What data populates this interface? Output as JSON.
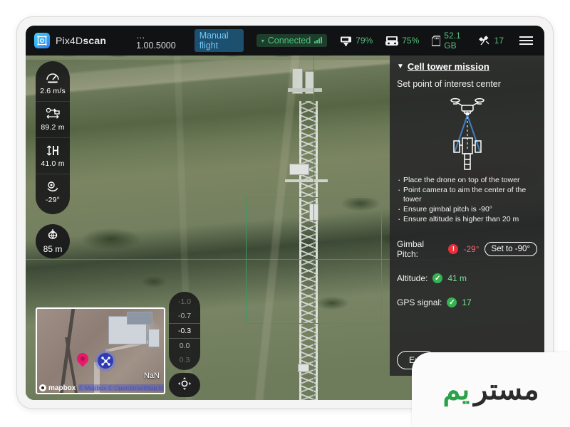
{
  "app": {
    "logo_icon": "pix4d-scan-logo-icon",
    "name_prefix": "Pix4D",
    "name_suffix": "scan",
    "version": "…1.00.5000",
    "flight_mode": "Manual flight",
    "connection": "Connected",
    "connection_caret_icon": "chevron-down-icon",
    "signal_icon": "signal-bars-icon",
    "menu_icon": "hamburger-menu-icon"
  },
  "status_bar": [
    {
      "icon": "drone-battery-icon",
      "value": "79%"
    },
    {
      "icon": "controller-battery-icon",
      "value": "75%"
    },
    {
      "icon": "sd-card-icon",
      "value": "52.1 GB"
    },
    {
      "icon": "satellite-icon",
      "value": "17"
    }
  ],
  "telemetry": [
    {
      "icon": "horizontal-speed-icon",
      "value": "2.6 m/s",
      "name": "speed"
    },
    {
      "icon": "horizontal-distance-icon",
      "value": "89.2 m",
      "name": "distance"
    },
    {
      "icon": "altitude-icon",
      "value": "41.0 m",
      "name": "altitude"
    },
    {
      "icon": "gimbal-pitch-icon",
      "value": "-29°",
      "name": "gimbal"
    }
  ],
  "distance_badge": {
    "icon": "home-distance-icon",
    "value": "85 m"
  },
  "gimbal_slider": {
    "ticks": [
      "-1.0",
      "-0.7",
      "-0.3",
      "0.0",
      "0.3"
    ],
    "current": "-0.3",
    "button_icon": "gimbal-control-icon"
  },
  "minimap": {
    "attribution_brand": "mapbox",
    "attribution_links": "© Mapbox  © OpenStreetMap  Improve this map",
    "place_label": "NaN",
    "marker_icon": "map-pin-icon",
    "drone_icon": "drone-marker-icon"
  },
  "panel": {
    "title": "Cell tower mission",
    "caret_icon": "caret-down-icon",
    "subtitle": "Set point of interest center",
    "diagram_icon": "drone-over-tower-diagram",
    "instructions": [
      "Place the drone on top of the tower",
      "Point camera to aim the center of the tower",
      "Ensure gimbal pitch is -90°",
      "Ensure altitude is higher than 20 m"
    ],
    "checks": [
      {
        "label": "Gimbal Pitch:",
        "status": "bad",
        "status_icon": "alert-icon",
        "value": "-29°",
        "action": "Set to -90°"
      },
      {
        "label": "Altitude:",
        "status": "ok",
        "status_icon": "check-icon",
        "value": "41 m",
        "action": null
      },
      {
        "label": "GPS signal:",
        "status": "ok",
        "status_icon": "check-icon",
        "value": "17",
        "action": null
      }
    ],
    "exit_label": "Exit",
    "next_label": ""
  },
  "viewfinder": {
    "roi_color": "#2f9e5e",
    "crosshair_color": "#2f9e5e"
  },
  "watermark": {
    "text": "مستر",
    "mark": "یم"
  },
  "colors": {
    "accent_blue": "#1b90d8",
    "ok_green": "#34b34f",
    "error_red": "#e8303c",
    "topbar_bg": "#111214",
    "panel_bg": "rgba(38,38,40,0.88)"
  }
}
